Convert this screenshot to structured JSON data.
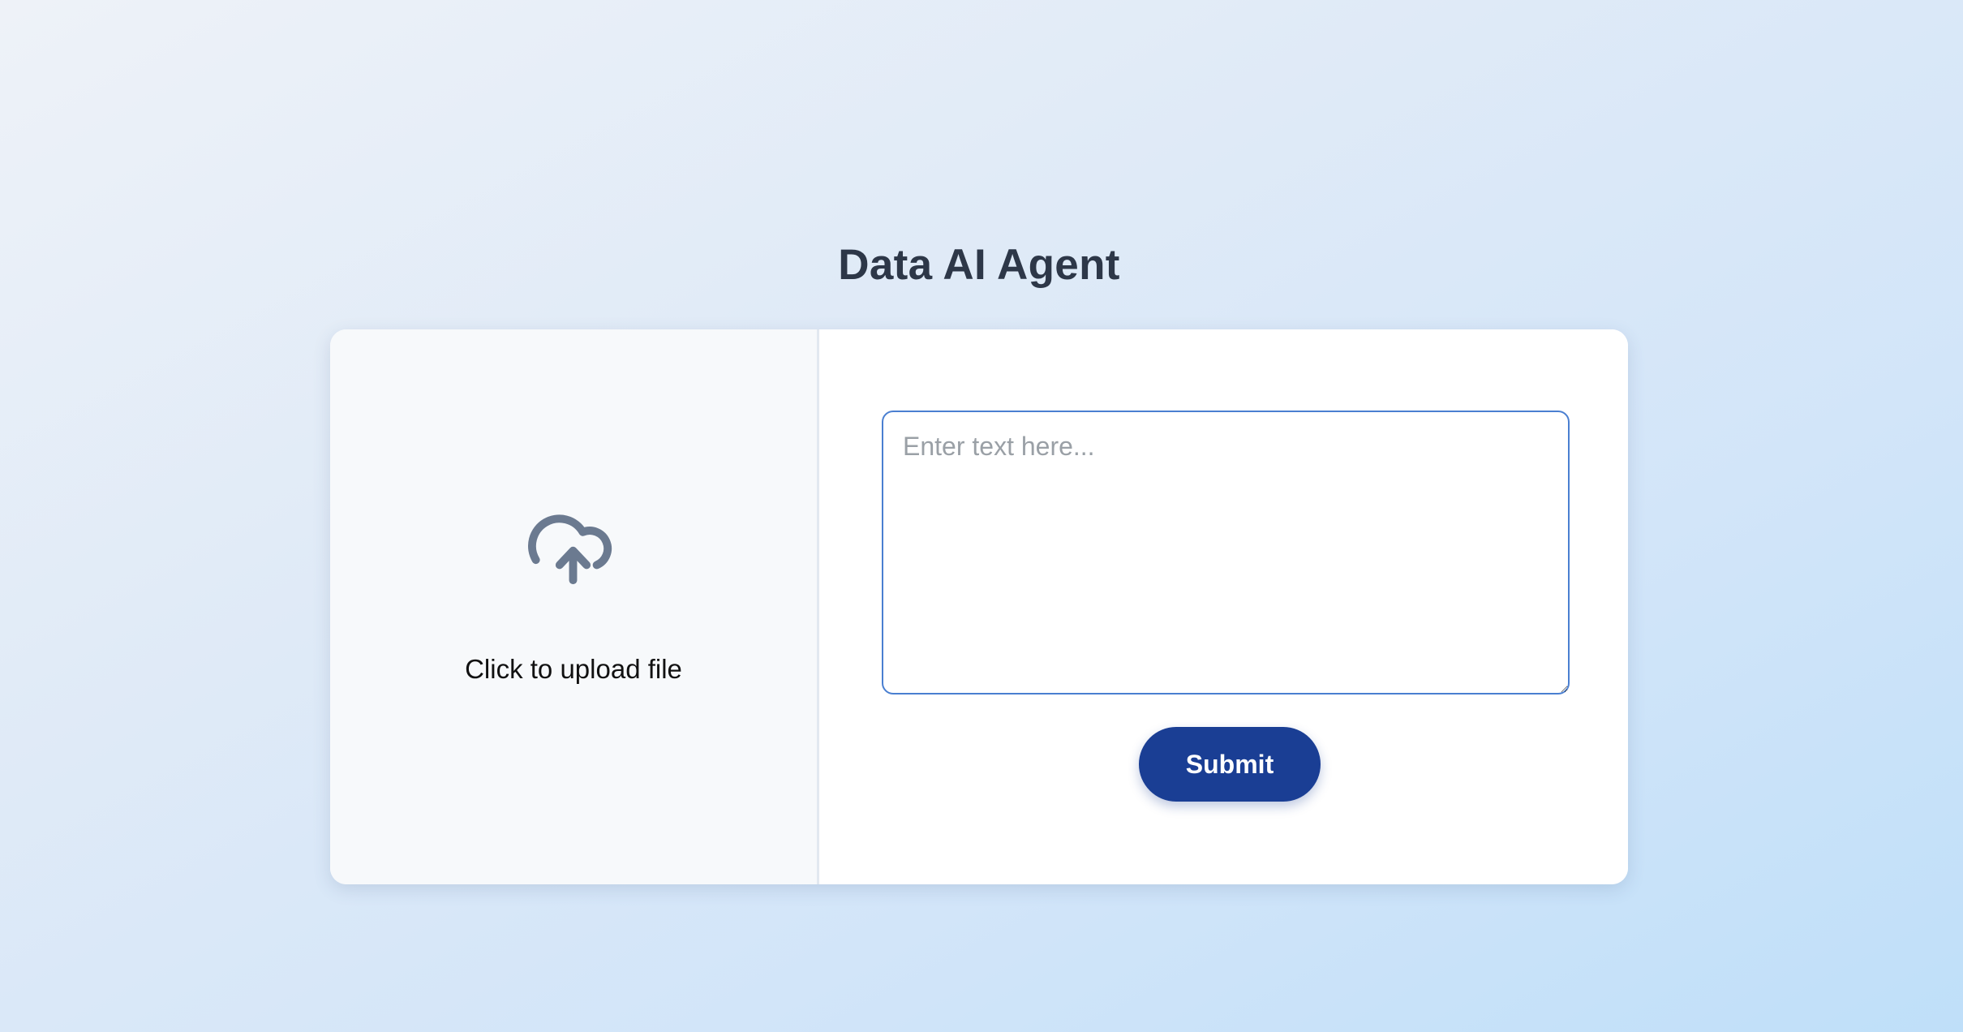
{
  "app": {
    "title": "Data AI Agent"
  },
  "upload": {
    "label": "Click to upload file",
    "icon": "cloud-upload-icon"
  },
  "text_input": {
    "value": "",
    "placeholder": "Enter text here..."
  },
  "actions": {
    "submit_label": "Submit"
  },
  "colors": {
    "accent": "#1a3e94",
    "title": "#2d3748",
    "input_border": "#4a7fd1",
    "icon": "#6b7a90"
  }
}
